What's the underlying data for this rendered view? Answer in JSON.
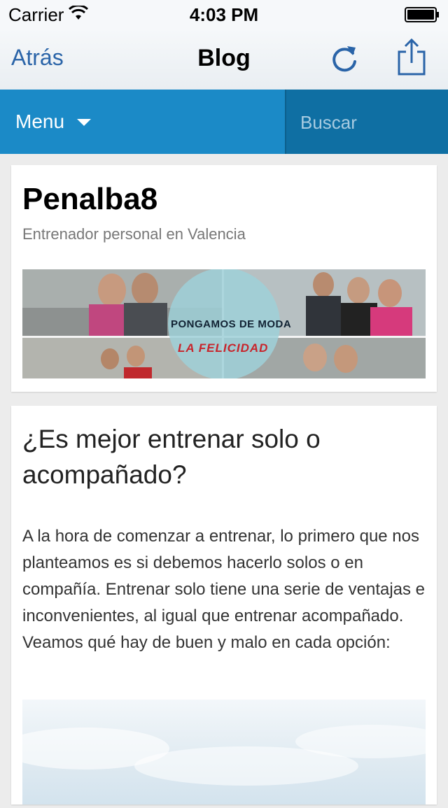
{
  "status_bar": {
    "carrier": "Carrier",
    "time": "4:03 PM"
  },
  "nav": {
    "back_label": "Atrás",
    "title": "Blog"
  },
  "menu_bar": {
    "menu_label": "Menu",
    "search_placeholder": "Buscar"
  },
  "site": {
    "title": "Penalba8",
    "subtitle": "Entrenador personal en Valencia",
    "banner_line1": "PONGAMOS DE MODA",
    "banner_line2": "LA FELICIDAD"
  },
  "post": {
    "title": "¿Es mejor entrenar solo o acompañado?",
    "body": "A la hora de comenzar a entrenar, lo primero que nos planteamos es si debemos hacerlo solos o en compañía. Entrenar solo tiene una serie de ventajas e inconvenientes, al igual que entrenar acompañado. Veamos qué hay de buen y malo en cada opción:"
  },
  "colors": {
    "accent": "#1b8ac7",
    "search_bg": "#0f6fa3",
    "link": "#2a64a8",
    "background": "#ececec"
  },
  "icons": {
    "wifi": "wifi-icon",
    "battery": "battery-icon",
    "refresh": "refresh-icon",
    "share": "share-icon",
    "menu_caret": "caret-down-icon"
  }
}
